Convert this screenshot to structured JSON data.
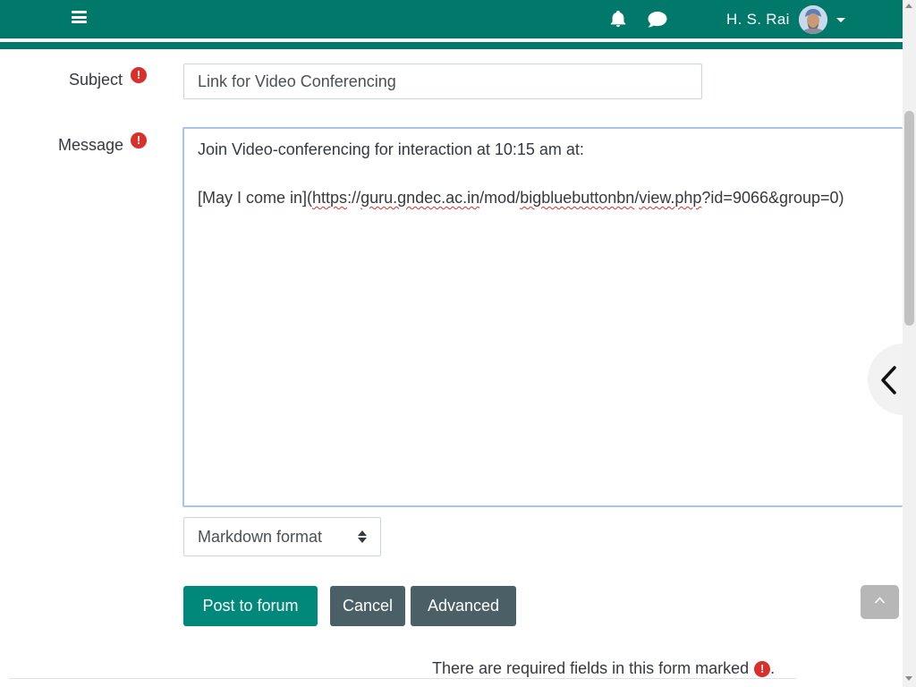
{
  "navbar": {
    "menu_icon": "hamburger-menu-icon",
    "notifications_icon": "bell-icon",
    "messages_icon": "chat-bubble-icon",
    "user_name": "H. S. Rai",
    "avatar_icon": "user-avatar",
    "dropdown_icon": "caret-down-icon",
    "color": "#00796b"
  },
  "form": {
    "subject": {
      "label": "Subject",
      "required_icon": "exclamation-circle-icon",
      "value": "Link for Video Conferencing"
    },
    "message": {
      "label": "Message",
      "required_icon": "exclamation-circle-icon",
      "lines": [
        "Join Video-conferencing for interaction at 10:15 am at:",
        "",
        "[May I come in](https://guru.gndec.ac.in/mod/bigbluebuttonbn/view.php?id=9066&group=0)"
      ],
      "link_line": {
        "p1": "[May I come in](",
        "p2": "https",
        "p3": "://",
        "p4": "guru.gndec.ac.in",
        "p5": "/mod/",
        "p6": "bigbluebuttonbn",
        "p7": "/",
        "p8": "view.php",
        "p9": "?id=9066&group=0)"
      }
    },
    "format_select": {
      "selected": "Markdown format"
    },
    "buttons": {
      "post": "Post to forum",
      "cancel": "Cancel",
      "advanced": "Advanced"
    },
    "required_note": "There are required fields in this form marked",
    "required_note_suffix": "."
  },
  "drawer_toggle_icon": "chevron-left-icon",
  "back_to_top_icon": "chevron-up-icon",
  "colors": {
    "primary": "#00897b",
    "secondary": "#4b5f67",
    "required": "#d9302b"
  }
}
